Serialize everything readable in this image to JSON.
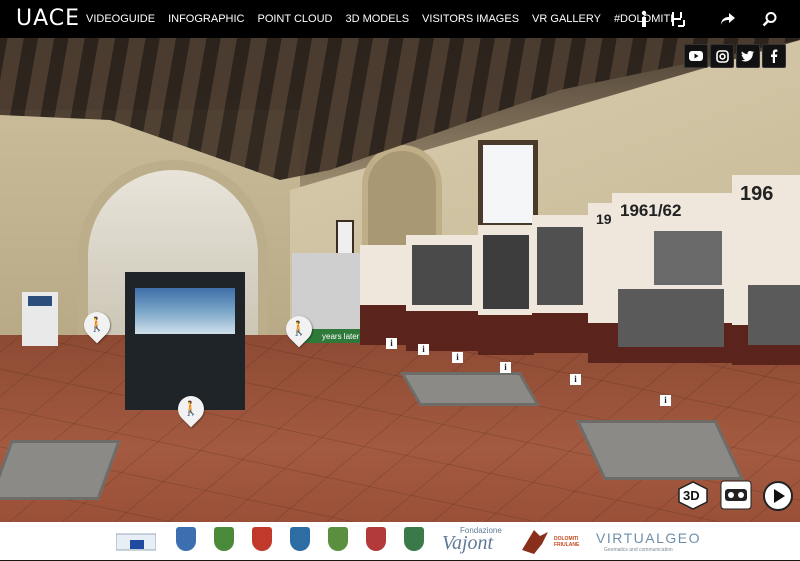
{
  "brand": {
    "logo": "UACE"
  },
  "nav": {
    "items": [
      {
        "label": "VIDEOGUIDE"
      },
      {
        "label": "INFOGRAPHIC"
      },
      {
        "label": "POINT CLOUD"
      },
      {
        "label": "3D MODELS"
      },
      {
        "label": "VISITORS IMAGES"
      },
      {
        "label": "VR GALLERY"
      },
      {
        "label": "#DOLOMITI"
      }
    ]
  },
  "toolbar_icons": [
    "info-icon",
    "ar-icon",
    "share-icon",
    "search-icon"
  ],
  "social": [
    "youtube-icon",
    "instagram-icon",
    "twitter-icon",
    "facebook-icon"
  ],
  "scene": {
    "panels": [
      {
        "year": "1963"
      },
      {
        "year": "1961/62"
      },
      {
        "year": "196"
      }
    ],
    "side_text": "years later"
  },
  "controls": {
    "mode_3d_label": "3D"
  },
  "footer": {
    "sponsor1_name": "Fondazione",
    "sponsor1_brand": "Vajont",
    "park_label": "DOLOMITI FRIULANE",
    "partner_brand": "VIRTUALGEO",
    "partner_tagline": "Geomatics and communication"
  },
  "colors": {
    "topbar": "#000000",
    "accent_brand": "#6f8fa8"
  }
}
